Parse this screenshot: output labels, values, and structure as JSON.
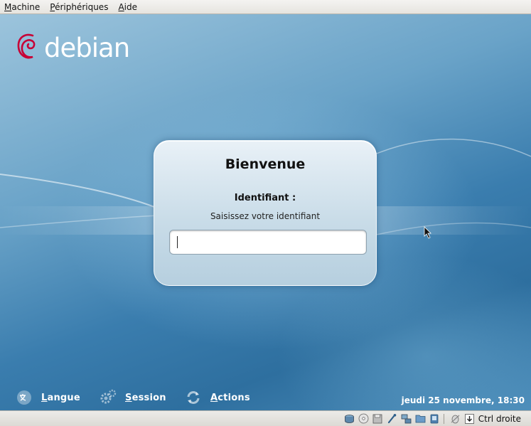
{
  "menubar": {
    "items": [
      {
        "label": "Machine"
      },
      {
        "label": "Périphériques"
      },
      {
        "label": "Aide"
      }
    ]
  },
  "logo": {
    "text": "debian",
    "color": "#c70036"
  },
  "login": {
    "title": "Bienvenue",
    "field_label": "Identifiant :",
    "hint": "Saisissez votre identifiant",
    "value": ""
  },
  "bottom": {
    "language": "Langue",
    "session": "Session",
    "actions": "Actions",
    "clock": "jeudi 25 novembre, 18:30"
  },
  "statusbar": {
    "icons": [
      "hard-disk-icon",
      "cdrom-icon",
      "floppy-icon",
      "usb-icon",
      "network-icon",
      "shared-folder-icon",
      "display-icon",
      "mouse-integration-icon",
      "hostkey-arrow-icon"
    ],
    "hostkey": "Ctrl droite"
  }
}
